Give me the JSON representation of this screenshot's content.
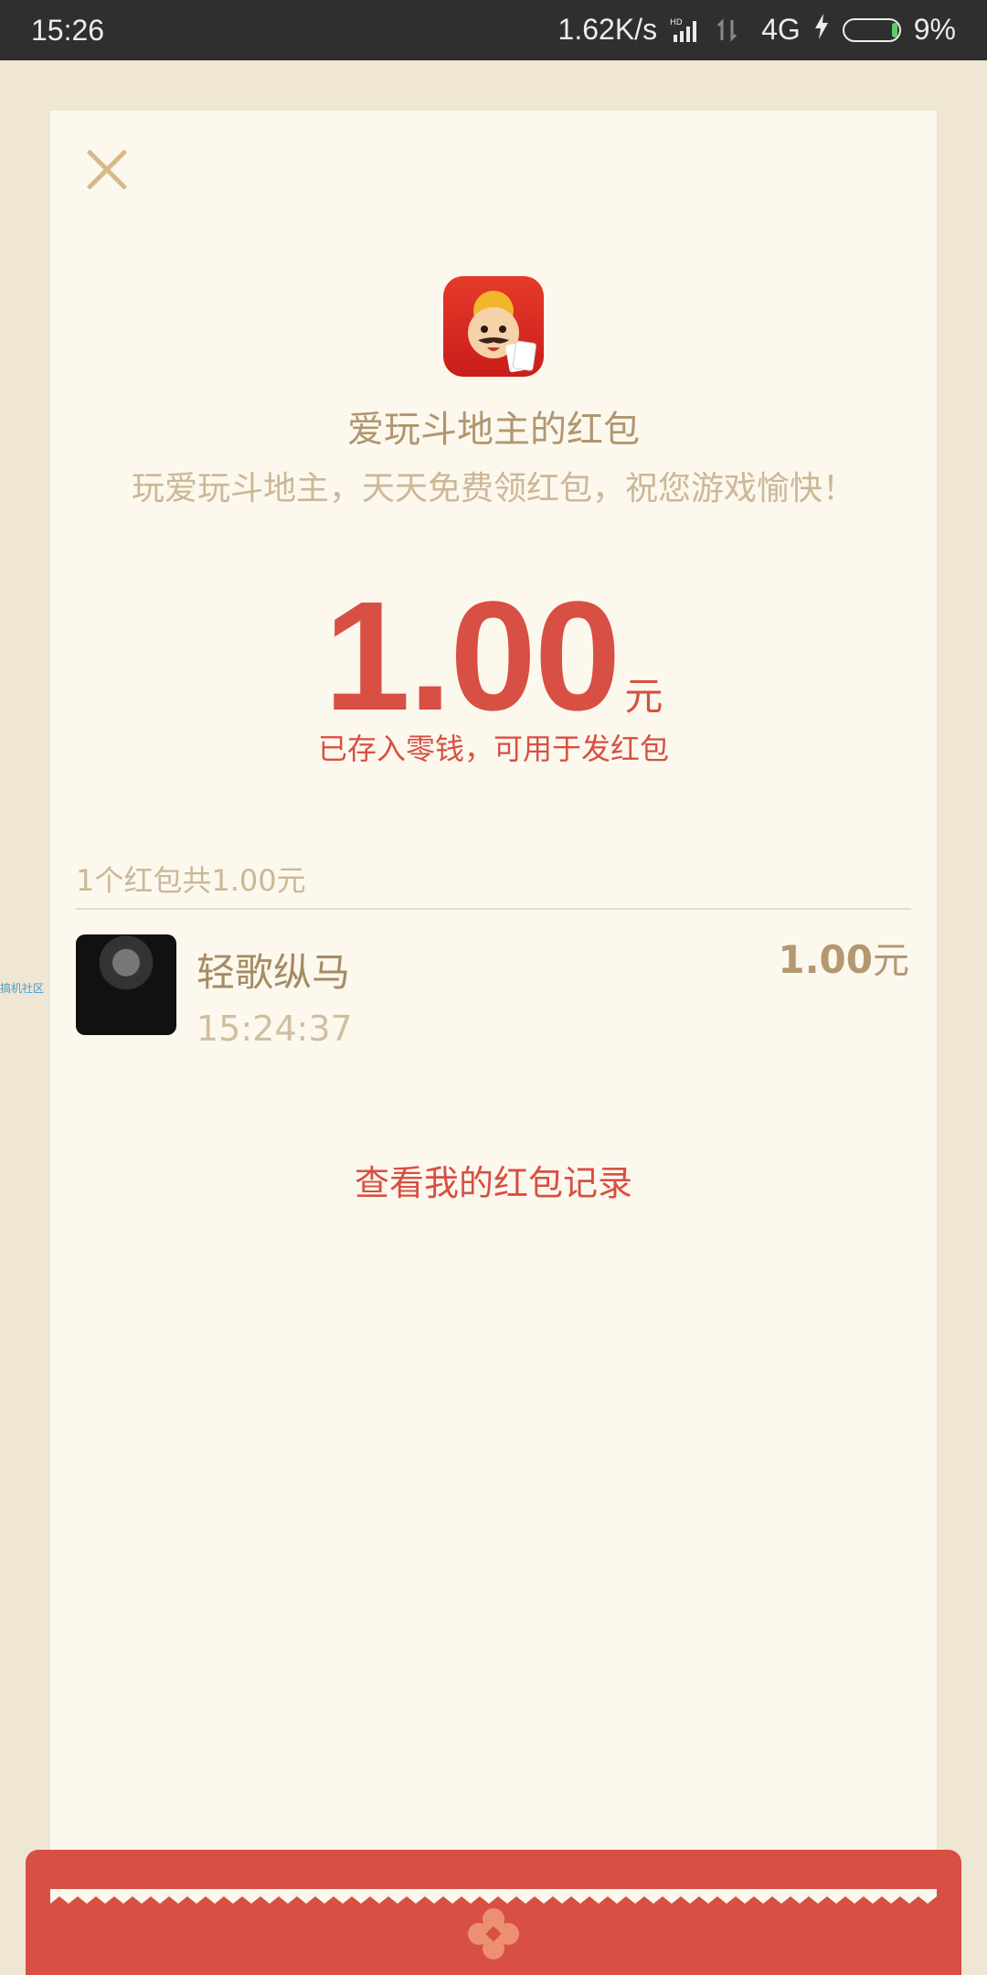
{
  "status_bar": {
    "time": "15:26",
    "speed": "1.62K/s",
    "hd": "HD",
    "network": "4G",
    "battery": "9%"
  },
  "side_label": "搞机社区",
  "header": {
    "title": "爱玩斗地主的红包",
    "wish": "玩爱玩斗地主，天天免费领红包，祝您游戏愉快！"
  },
  "amount": {
    "value": "1.00",
    "unit": "元",
    "note": "已存入零钱，可用于发红包"
  },
  "list": {
    "summary": "1个红包共1.00元",
    "items": [
      {
        "name": "轻歌纵马",
        "time": "15:24:37",
        "amount": "1.00",
        "unit": "元"
      }
    ]
  },
  "footer": {
    "record_link": "查看我的红包记录"
  },
  "colors": {
    "accent_red": "#d84f43",
    "gold": "#b09670",
    "page_bg": "#efe6d3",
    "sheet_bg": "#fcf8ed"
  },
  "icons": {
    "close": "close-icon",
    "app": "app-icon",
    "flower": "flower-icon"
  }
}
